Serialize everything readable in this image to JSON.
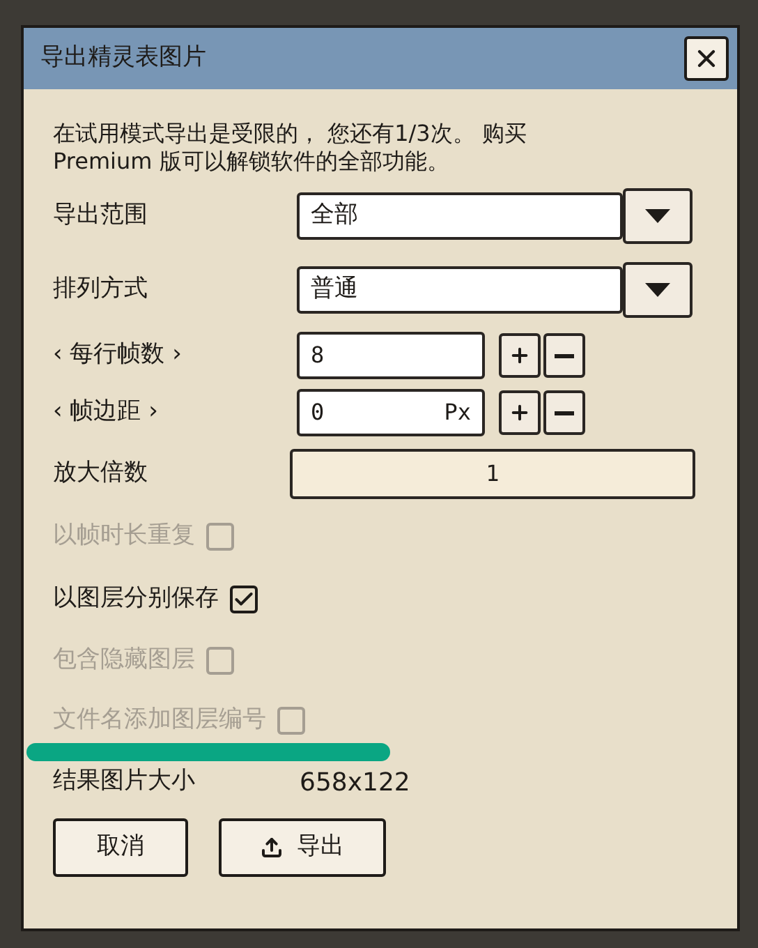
{
  "dialog": {
    "title": "导出精灵表图片",
    "notice": "在试用模式导出是受限的， 您还有1/3次。 购买 Premium 版可以解锁软件的全部功能。",
    "fields": [
      {
        "kind": "dropdown",
        "label": "导出范围",
        "value": "全部"
      },
      {
        "kind": "dropdown",
        "label": "排列方式",
        "value": "普通"
      },
      {
        "kind": "spin",
        "label": "‹ 每行帧数 ›",
        "value": "8"
      },
      {
        "kind": "spin",
        "label": "‹ 帧边距 ›",
        "value": "0",
        "unit": "Px"
      },
      {
        "kind": "bar",
        "label": "放大倍数",
        "value": "1"
      }
    ],
    "checkboxes": [
      {
        "label": "以帧时长重复",
        "checked": false,
        "disabled": true
      },
      {
        "label": "以图层分别保存",
        "checked": true,
        "disabled": false
      },
      {
        "label": "包含隐藏图层",
        "checked": false,
        "disabled": true
      },
      {
        "label": "文件名添加图层编号",
        "checked": false,
        "disabled": true
      }
    ],
    "result": {
      "label": "结果图片大小",
      "value": "658x122"
    },
    "buttons": [
      {
        "kind": "plain",
        "label": "取消"
      },
      {
        "kind": "export",
        "label": "导出"
      }
    ]
  }
}
